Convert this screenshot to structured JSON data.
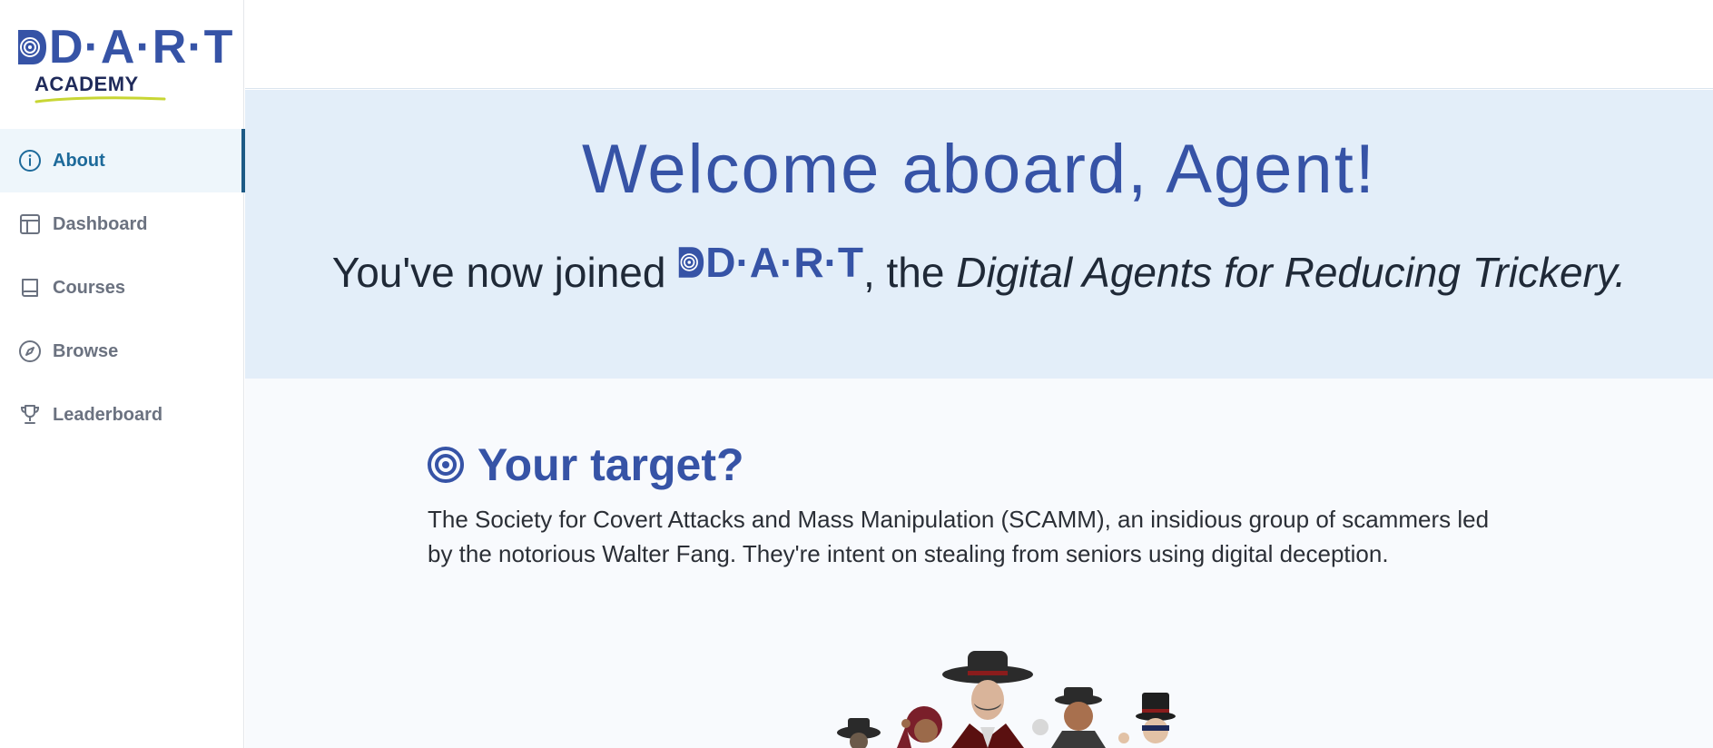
{
  "brand": {
    "logo_text": "D·A·R·T",
    "logo_subtext": "ACADEMY",
    "colors": {
      "primary": "#3653a6",
      "active_nav": "#1d6a9a",
      "hero_bg": "#e3eef9",
      "accent_underline": "#c8d634"
    }
  },
  "sidebar": {
    "items": [
      {
        "label": "About",
        "icon": "info-icon",
        "active": true
      },
      {
        "label": "Dashboard",
        "icon": "layout-icon",
        "active": false
      },
      {
        "label": "Courses",
        "icon": "book-icon",
        "active": false
      },
      {
        "label": "Browse",
        "icon": "compass-icon",
        "active": false
      },
      {
        "label": "Leaderboard",
        "icon": "trophy-icon",
        "active": false
      }
    ]
  },
  "hero": {
    "title": "Welcome aboard, Agent!",
    "sub_prefix": "You've now joined",
    "sub_logo": "D·A·R·T",
    "sub_middle": ", the",
    "sub_italic": "Digital Agents for Reducing Trickery."
  },
  "main": {
    "section_icon": "target-icon",
    "section_title": "Your target?",
    "section_text": "The Society for Covert Attacks and Mass Manipulation (SCAMM), an insidious group of scammers led by the notorious Walter Fang. They're intent on stealing from seniors using digital deception."
  }
}
